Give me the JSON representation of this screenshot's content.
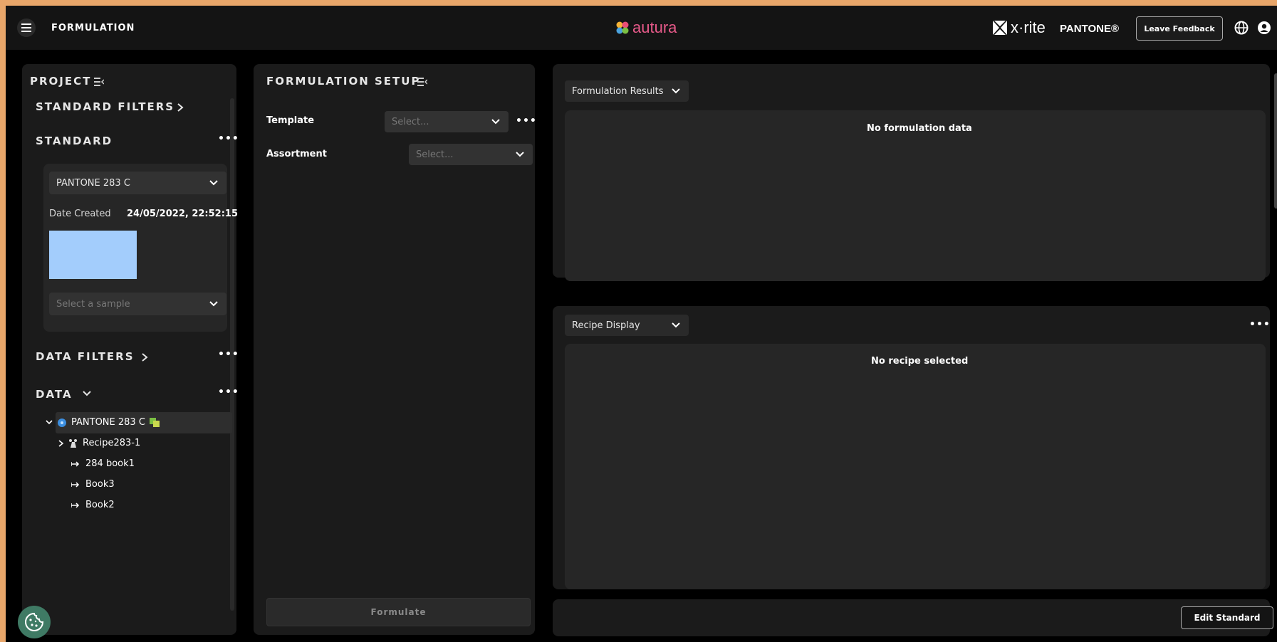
{
  "header": {
    "title": "FORMULATION",
    "logo_text": "autura",
    "brand_xrite": "x·rite",
    "brand_pantone": "PANTONE®",
    "feedback_label": "Leave Feedback"
  },
  "project": {
    "title": "PROJECT",
    "standard_filters": "STANDARD FILTERS",
    "standard": "STANDARD",
    "standard_select_value": "PANTONE 283 C",
    "date_label": "Date Created",
    "date_value": "24/05/2022, 22:52:15",
    "swatch_color": "#a3cdfc",
    "sample_placeholder": "Select a sample",
    "data_filters": "DATA FILTERS",
    "data": "DATA",
    "tree": [
      {
        "label": "PANTONE 283 C",
        "level": 0
      },
      {
        "label": "Recipe283-1",
        "level": 1
      },
      {
        "label": "284 book1",
        "level": 1
      },
      {
        "label": "Book3",
        "level": 1
      },
      {
        "label": "Book2",
        "level": 1
      }
    ]
  },
  "setup": {
    "title": "FORMULATION SETUP",
    "template_label": "Template",
    "template_placeholder": "Select...",
    "assortment_label": "Assortment",
    "assortment_placeholder": "Select...",
    "formulate_label": "Formulate"
  },
  "results": {
    "dropdown_label": "Formulation Results",
    "empty_message": "No formulation data"
  },
  "recipe": {
    "dropdown_label": "Recipe Display",
    "empty_message": "No recipe selected"
  },
  "footer": {
    "edit_label": "Edit Standard"
  }
}
